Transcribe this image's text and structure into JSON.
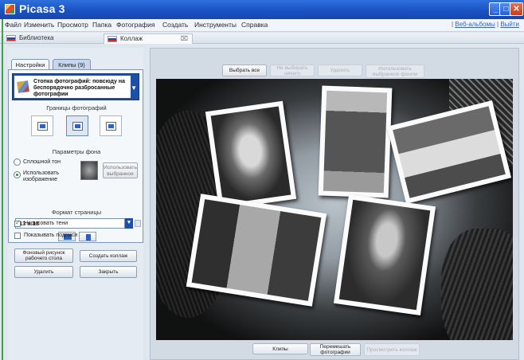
{
  "window": {
    "title": "Picasa 3",
    "minimize": "_",
    "maximize": "□",
    "close": "✕"
  },
  "menu": {
    "items": [
      "Файл",
      "Изменить",
      "Просмотр",
      "Папка",
      "Фотография",
      "Создать",
      "Инструменты",
      "Справка"
    ],
    "web_albums": "Веб-альбомы",
    "separator": "|",
    "logout": "Выйти"
  },
  "doc_tabs": [
    {
      "label": "Библиотека"
    },
    {
      "label": "Коллаж",
      "close": "⌧"
    }
  ],
  "left": {
    "tabs": [
      "Настройки",
      "Клипы (9)"
    ],
    "style_select": {
      "label": "Стопка фотографий: повсюду на беспорядочно разбросанные фотографии",
      "arrow": "▼"
    },
    "borders_label": "Границы фотографий",
    "bg_label": "Параметры фона",
    "solid_color": "Сплошной тон",
    "use_image": "Использовать изображение",
    "use_selected": "Использовать выбранное",
    "page_format_label": "Формат страницы",
    "page_format_value": "13 x 18",
    "size_arrow": "▼",
    "draw_shadows": "Нарисовать тени",
    "show_captions": "Показывать подписи",
    "wallpaper_btn": "Фоновый рисунок рабочего стола",
    "create_collage_btn": "Создать коллаж",
    "discard_btn": "Удалить",
    "close_btn": "Закрыть"
  },
  "toolbar": {
    "select_all": "Выбрать все",
    "deselect_all": "Не выбирать ничего",
    "delete": "Удалить",
    "use_selected_bg": "Использовать выбранное фоном"
  },
  "bottom": {
    "clips": "Клипы",
    "shuffle": "Перемешать фотографии",
    "view_collage": "Просмотреть коллаж"
  },
  "photos": [
    {
      "subject": "portrait-girl"
    },
    {
      "subject": "two-women-standing"
    },
    {
      "subject": "three-women-outdoors"
    },
    {
      "subject": "three-girls-smiling"
    },
    {
      "subject": "young-man-portrait"
    }
  ],
  "colors": {
    "titlebar": "#1a52c4",
    "accent_select": "#1c4fa8",
    "panel_border": "#7d95b6"
  }
}
